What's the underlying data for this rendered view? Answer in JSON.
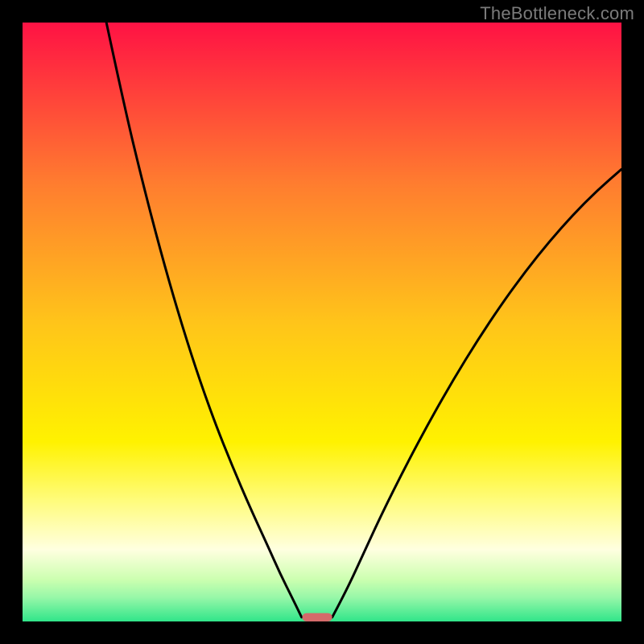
{
  "watermark": "TheBottleneck.com",
  "chart_data": {
    "type": "line",
    "title": "",
    "xlabel": "",
    "ylabel": "",
    "xlim": [
      0,
      100
    ],
    "ylim": [
      0,
      100
    ],
    "grid": false,
    "legend": false,
    "background": {
      "type": "vertical-gradient",
      "stops": [
        {
          "pos": 0.0,
          "color": "#ff1244"
        },
        {
          "pos": 0.27,
          "color": "#ff7d2f"
        },
        {
          "pos": 0.5,
          "color": "#ffc41a"
        },
        {
          "pos": 0.7,
          "color": "#fff200"
        },
        {
          "pos": 0.8,
          "color": "#fffc7e"
        },
        {
          "pos": 0.88,
          "color": "#ffffe0"
        },
        {
          "pos": 0.93,
          "color": "#ccffb0"
        },
        {
          "pos": 0.96,
          "color": "#97f7a8"
        },
        {
          "pos": 1.0,
          "color": "#30e58a"
        }
      ]
    },
    "series": [
      {
        "name": "left-branch",
        "stroke": "#000000",
        "stroke_width": 3,
        "x": [
          14.0,
          17.0,
          20.0,
          23.0,
          26.0,
          29.0,
          32.0,
          35.0,
          38.0,
          41.0,
          43.0,
          45.0,
          46.6
        ],
        "y": [
          100.0,
          86.0,
          73.5,
          62.0,
          51.5,
          42.0,
          33.5,
          26.0,
          19.0,
          12.5,
          8.0,
          4.0,
          0.7
        ]
      },
      {
        "name": "right-branch",
        "stroke": "#000000",
        "stroke_width": 3,
        "x": [
          51.7,
          54.0,
          57.0,
          60.0,
          64.0,
          68.0,
          72.0,
          76.0,
          80.0,
          84.0,
          88.0,
          92.0,
          96.0,
          100.0
        ],
        "y": [
          0.7,
          5.0,
          11.5,
          18.0,
          26.0,
          33.5,
          40.5,
          47.0,
          53.0,
          58.5,
          63.5,
          68.0,
          72.0,
          75.5
        ]
      }
    ],
    "marker": {
      "name": "target-bar",
      "shape": "rounded-rect",
      "x_center": 49.2,
      "y_bottom": 0.0,
      "width": 5.0,
      "height": 1.4,
      "fill": "#d46a6a"
    }
  }
}
